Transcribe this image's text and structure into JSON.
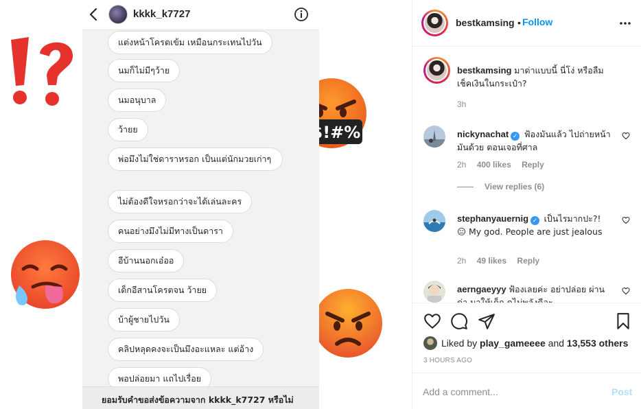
{
  "dm": {
    "username": "kkkk_k7727",
    "messages": [
      "แต่งหน้าโครตเข้ม เหมือนกระเทนไปวัน",
      "นมก็ไม่มีๆว้าย",
      "นมอนุบาล",
      "ว้ายย",
      "พ่อมึงไม่ใช่ดาราหรอก เป็นแต่นักมวยเก่าๆ",
      "ไม่ต้องดีใจหรอกว่าจะได้เล่นละคร",
      "คนอย่างมึงไม่มีทางเป็นดารา",
      "อีบ้านนอกเอ๋ออ",
      "เด็กอีสานโครตจน ว้ายย",
      "บ้าผู้ชายไปวัน",
      "คลิปหลุดคงจะเป็นมึงอะแหละ แต่อ้าง",
      "พอปล่อยมา แถไปเรื่อย"
    ],
    "request_text": "ยอมรับคำขอส่งข้อความจาก kkkk_k7727 หรือไม่"
  },
  "stickers": {
    "exclaim_question": "⁉",
    "cursing_text": "&$!#%"
  },
  "post": {
    "username": "bestkamsing",
    "dot": "•",
    "follow_label": "Follow",
    "caption": {
      "username": "bestkamsing",
      "text": "มาด่าแบบนี้ นี่โง่ หรือลืมเช็คเงินในกระเป๋า?",
      "time": "3h"
    },
    "comments": [
      {
        "username": "nickynachat",
        "verified": true,
        "text": "ฟ้องมันแล้ว ไปถ่ายหน้ามันด้วย ตอนเจอที่ศาล",
        "time": "2h",
        "likes": "400 likes",
        "reply_label": "Reply"
      },
      {
        "username": "stephanyauernig",
        "verified": true,
        "text": "เป็นไรมากปะ?! 😑 My god. People are just jealous",
        "time": "2h",
        "likes": "49 likes",
        "reply_label": "Reply"
      },
      {
        "username": "aerngaeyyy",
        "verified": false,
        "text": "ฟ้องเลยค่ะ อย่าปล่อย ผ่านด่า มาให้เด็ก ดูไม่พลังดีอะ"
      }
    ],
    "view_replies": "View replies (6)",
    "liked_by_prefix": "Liked by",
    "liked_by_user": "play_gameeee",
    "liked_by_and": "and",
    "liked_by_others": "13,553 others",
    "timestamp": "3 HOURS AGO",
    "comment_placeholder": "Add a comment...",
    "post_label": "Post"
  },
  "colors": {
    "accent": "#0095f6",
    "post_disabled": "#b2dffc",
    "verified": "#3897f0",
    "exclaim_red": "#e5322d",
    "emoji_yellow": "#f4a100",
    "emoji_red": "#e8472b"
  },
  "icons": [
    "chevron-left-icon",
    "info-icon",
    "more-options-icon",
    "heart-icon",
    "comment-icon",
    "share-icon",
    "bookmark-icon",
    "verified-icon"
  ]
}
